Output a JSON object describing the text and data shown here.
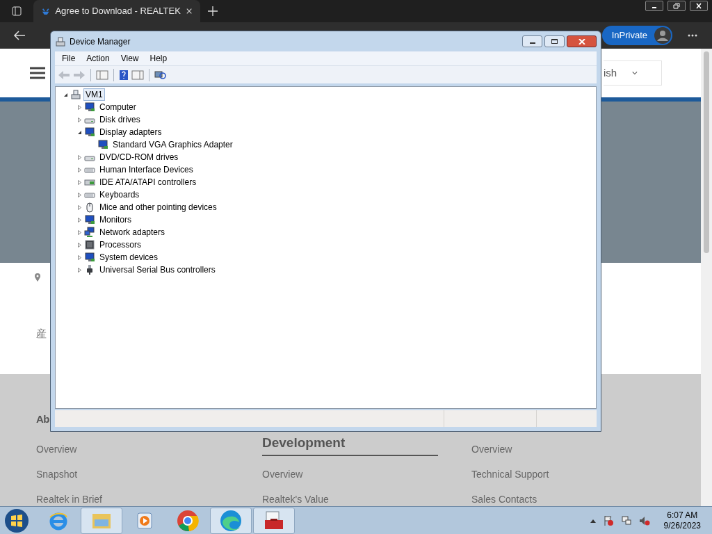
{
  "browser": {
    "tab": {
      "title": "Agree to Download - REALTEK"
    },
    "inprivate_label": "InPrivate",
    "page": {
      "language": "ish",
      "location_text": "産",
      "footer": {
        "columns": [
          {
            "heading": "Ab",
            "links": [
              "Overview",
              "Snapshot",
              "Realtek in Brief"
            ]
          },
          {
            "heading": "Development",
            "links": [
              "Overview",
              "Realtek's Value"
            ]
          },
          {
            "links": [
              "Overview",
              "Technical Support",
              "Sales Contacts"
            ]
          }
        ]
      }
    }
  },
  "device_manager": {
    "title": "Device Manager",
    "menu": [
      "File",
      "Action",
      "View",
      "Help"
    ],
    "tree": {
      "label": "VM1",
      "selected": true,
      "expanded": true,
      "children": [
        {
          "label": "Computer",
          "selected": false,
          "expanded": false
        },
        {
          "label": "Disk drives",
          "selected": false,
          "expanded": false
        },
        {
          "label": "Display adapters",
          "selected": false,
          "expanded": true,
          "children": [
            {
              "label": "Standard VGA Graphics Adapter",
              "selected": false
            }
          ]
        },
        {
          "label": "DVD/CD-ROM drives",
          "selected": false,
          "expanded": false
        },
        {
          "label": "Human Interface Devices",
          "selected": false,
          "expanded": false
        },
        {
          "label": "IDE ATA/ATAPI controllers",
          "selected": false,
          "expanded": false
        },
        {
          "label": "Keyboards",
          "selected": false,
          "expanded": false
        },
        {
          "label": "Mice and other pointing devices",
          "selected": false,
          "expanded": false
        },
        {
          "label": "Monitors",
          "selected": false,
          "expanded": false
        },
        {
          "label": "Network adapters",
          "selected": false,
          "expanded": false
        },
        {
          "label": "Processors",
          "selected": false,
          "expanded": false
        },
        {
          "label": "System devices",
          "selected": false,
          "expanded": false
        },
        {
          "label": "Universal Serial Bus controllers",
          "selected": false,
          "expanded": false
        }
      ]
    }
  },
  "taskbar": {
    "apps": [
      {
        "running": false
      },
      {
        "running": true
      },
      {
        "running": false
      },
      {
        "running": false
      },
      {
        "running": true
      },
      {
        "running": true
      }
    ],
    "tray": {
      "time": "6:07 AM",
      "date": "9/26/2023"
    }
  }
}
